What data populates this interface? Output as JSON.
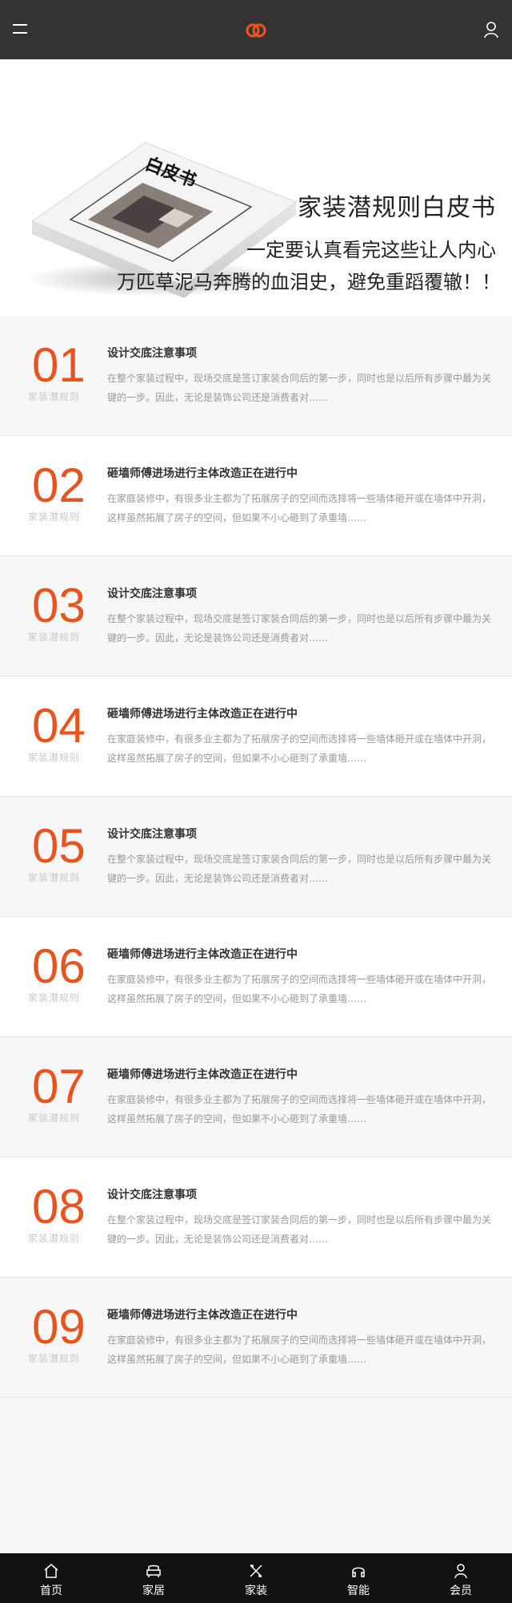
{
  "header": {
    "menu_icon": "hamburger-menu-icon",
    "logo_icon": "interlocking-rings-logo",
    "user_icon": "user-icon",
    "accent_color": "#e8531e",
    "background_color": "#333333"
  },
  "hero": {
    "book_image": "book-cover-illustration",
    "book_cover_title": "白皮书",
    "title": "家装潜规则白皮书",
    "line1": "一定要认真看完这些让人内心",
    "line2": "万匹草泥马奔腾的血泪史，避免重蹈覆辙！！"
  },
  "items": [
    {
      "num": "01",
      "sub": "家装潜规则",
      "title": "设计交底注意事项",
      "desc": "在整个家装过程中，现场交底是签订家装合同后的第一步，同时也是以后所有步骤中最为关键的一步。因此，无论是装饰公司还是消费者对……"
    },
    {
      "num": "02",
      "sub": "家装潜规则",
      "title": "砸墙师傅进场进行主体改造正在进行中",
      "desc": "在家庭装修中，有很多业主都为了拓展房子的空间而选择将一些墙体砸开或在墙体中开洞，这样虽然拓展了房子的空间，但如果不小心砸到了承重墙……"
    },
    {
      "num": "03",
      "sub": "家装潜规则",
      "title": "设计交底注意事项",
      "desc": "在整个家装过程中，现场交底是签订家装合同后的第一步，同时也是以后所有步骤中最为关键的一步。因此，无论是装饰公司还是消费者对……"
    },
    {
      "num": "04",
      "sub": "家装潜规则",
      "title": "砸墙师傅进场进行主体改造正在进行中",
      "desc": "在家庭装修中，有很多业主都为了拓展房子的空间而选择将一些墙体砸开或在墙体中开洞，这样虽然拓展了房子的空间，但如果不小心砸到了承重墙……"
    },
    {
      "num": "05",
      "sub": "家装潜规则",
      "title": "设计交底注意事项",
      "desc": "在整个家装过程中，现场交底是签订家装合同后的第一步，同时也是以后所有步骤中最为关键的一步。因此，无论是装饰公司还是消费者对……"
    },
    {
      "num": "06",
      "sub": "家装潜规则",
      "title": "砸墙师傅进场进行主体改造正在进行中",
      "desc": "在家庭装修中，有很多业主都为了拓展房子的空间而选择将一些墙体砸开或在墙体中开洞，这样虽然拓展了房子的空间，但如果不小心砸到了承重墙……"
    },
    {
      "num": "07",
      "sub": "家装潜规则",
      "title": "砸墙师傅进场进行主体改造正在进行中",
      "desc": "在家庭装修中，有很多业主都为了拓展房子的空间而选择将一些墙体砸开或在墙体中开洞，这样虽然拓展了房子的空间，但如果不小心砸到了承重墙……"
    },
    {
      "num": "08",
      "sub": "家装潜规则",
      "title": "设计交底注意事项",
      "desc": "在整个家装过程中，现场交底是签订家装合同后的第一步，同时也是以后所有步骤中最为关键的一步。因此，无论是装饰公司还是消费者对……"
    },
    {
      "num": "09",
      "sub": "家装潜规则",
      "title": "砸墙师傅进场进行主体改造正在进行中",
      "desc": "在家庭装修中，有很多业主都为了拓展房子的空间而选择将一些墙体砸开或在墙体中开洞，这样虽然拓展了房子的空间，但如果不小心砸到了承重墙……"
    }
  ],
  "bottom_nav": [
    {
      "label": "首页",
      "icon": "home-icon"
    },
    {
      "label": "家居",
      "icon": "sofa-icon"
    },
    {
      "label": "家装",
      "icon": "tools-icon"
    },
    {
      "label": "智能",
      "icon": "headset-icon"
    },
    {
      "label": "会员",
      "icon": "user-icon"
    }
  ]
}
